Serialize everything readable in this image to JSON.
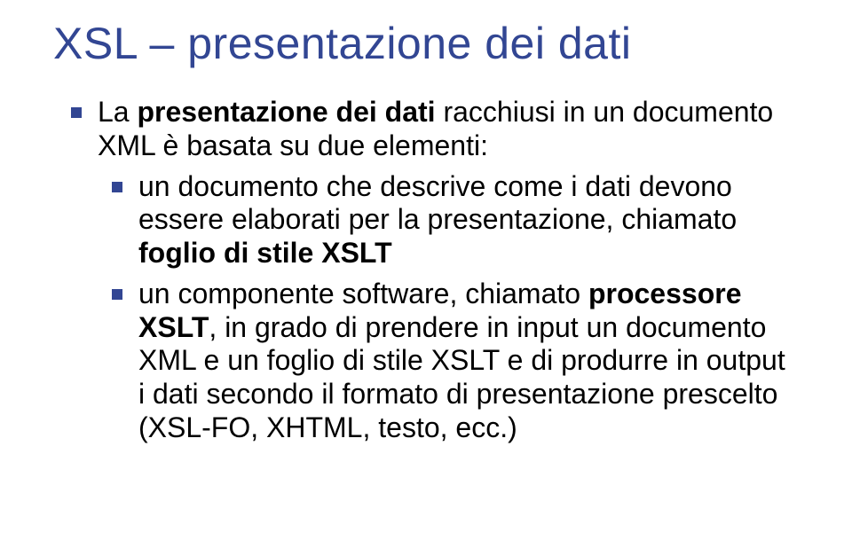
{
  "title": "XSL – presentazione dei dati",
  "bullets": {
    "b1_pre": "La ",
    "b1_bold": "presentazione dei dati",
    "b1_post": " racchiusi in un documento XML è basata su due elementi:",
    "b2_pre": "un documento che descrive come i dati devono essere elaborati per la presentazione, chiamato ",
    "b2_bold": "foglio di stile XSLT",
    "b3_pre": "un componente software, chiamato ",
    "b3_bold": "processore XSLT",
    "b3_post": ", in grado di prendere in input un documento XML e un foglio di stile XSLT e di produrre in output i dati secondo il formato di presentazione prescelto (XSL-FO, XHTML, testo, ecc.)"
  }
}
